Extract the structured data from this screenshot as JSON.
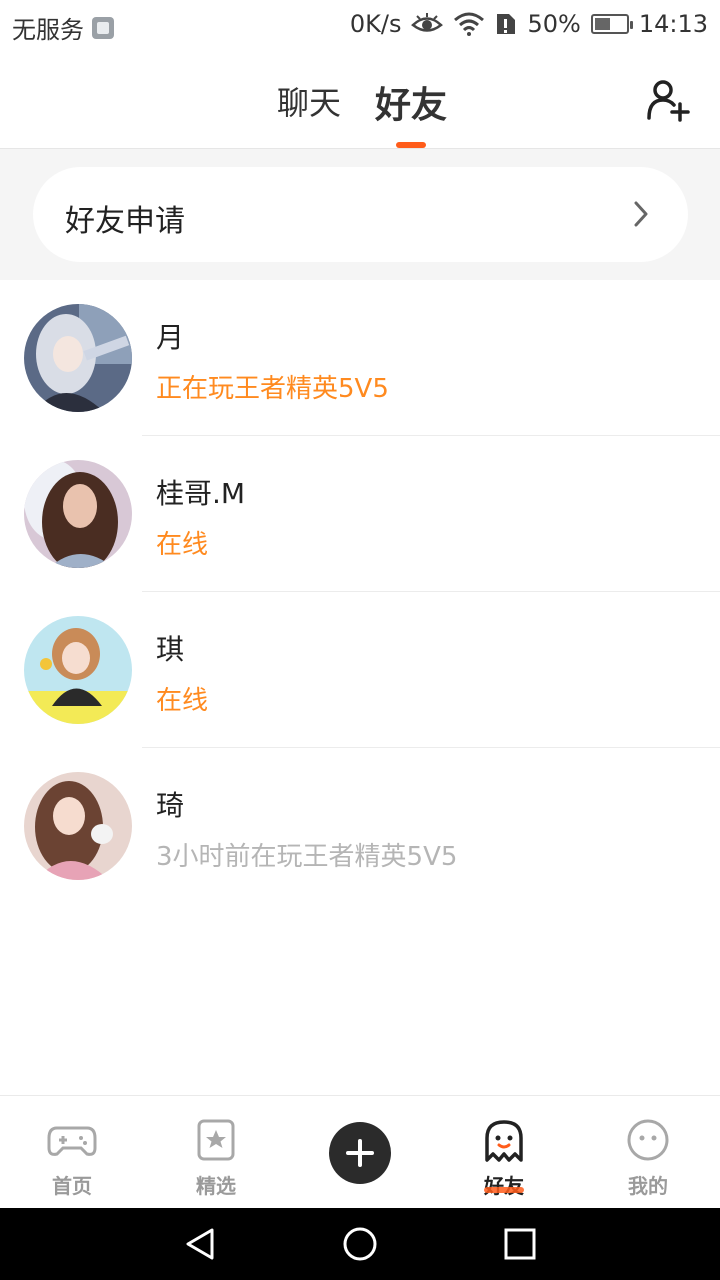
{
  "status_bar": {
    "carrier": "无服务",
    "speed": "0K/s",
    "battery": "50%",
    "battery_level": 0.5,
    "time": "14:13"
  },
  "header": {
    "tabs": [
      {
        "label": "聊天",
        "active": false
      },
      {
        "label": "好友",
        "active": true
      }
    ],
    "add_friend_icon": "add-person-icon"
  },
  "friend_request": {
    "label": "好友申请"
  },
  "friends": [
    {
      "name": "月",
      "status": "正在玩王者精英5V5",
      "status_color": "#ff8a1f"
    },
    {
      "name": "桂哥.M",
      "status": "在线",
      "status_color": "#ff8a1f"
    },
    {
      "name": "琪",
      "status": "在线",
      "status_color": "#ff8a1f"
    },
    {
      "name": "琦",
      "status": "3小时前在玩王者精英5V5",
      "status_color": "#b5b5b5"
    }
  ],
  "bottom_nav": {
    "items": [
      {
        "label": "首页",
        "icon": "gamepad-icon",
        "active": false
      },
      {
        "label": "精选",
        "icon": "star-bookmark-icon",
        "active": false
      },
      {
        "label": "",
        "icon": "plus-icon",
        "active": false
      },
      {
        "label": "好友",
        "icon": "ghost-icon",
        "active": true
      },
      {
        "label": "我的",
        "icon": "face-icon",
        "active": false
      }
    ]
  },
  "colors": {
    "accent": "#ff5c1a",
    "online": "#ff8a1f",
    "offline": "#b5b5b5"
  }
}
